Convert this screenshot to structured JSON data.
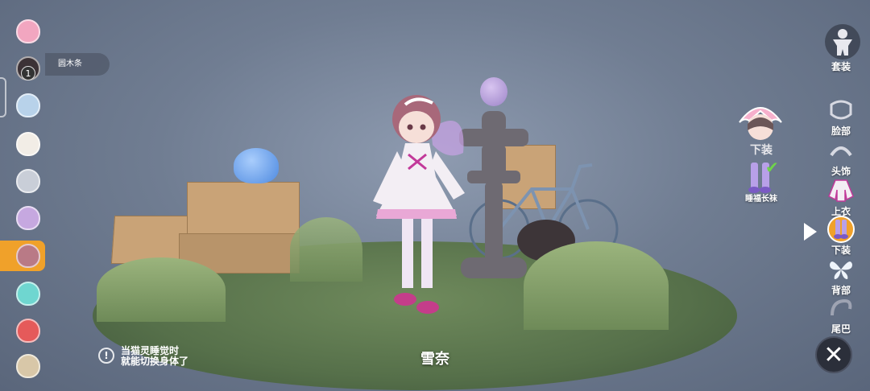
{
  "hud": {
    "hint_icon": "!",
    "hint_line1": "当猫灵睡觉时",
    "hint_line2": "就能切换身体了",
    "character_name": "雪奈"
  },
  "left_list": {
    "badge_count": "1",
    "tooltip": "圆木条",
    "items": [
      {
        "icon": "pink-cat-face-icon",
        "color": "#f2a6c0"
      },
      {
        "icon": "dark-cat-face-icon",
        "color": "#3c3236"
      },
      {
        "icon": "blue-hair-face-icon",
        "color": "#b8d2ea"
      },
      {
        "icon": "white-sheep-face-icon",
        "color": "#f2ede6"
      },
      {
        "icon": "grey-cat-face-icon",
        "color": "#c9ced8"
      },
      {
        "icon": "purple-cat-face-icon",
        "color": "#c6a8e0"
      },
      {
        "icon": "brown-hair-face-icon",
        "color": "#b97a86"
      },
      {
        "icon": "teal-hair-face-icon",
        "color": "#6fd6d0"
      },
      {
        "icon": "red-cat-face-icon",
        "color": "#e55a5a"
      },
      {
        "icon": "owl-face-icon",
        "color": "#d8c7a8"
      }
    ],
    "accent": "#f0a12a"
  },
  "right_list": {
    "categories": [
      {
        "label": "套装",
        "icon": "body-outfit-icon"
      },
      {
        "label": "脸部",
        "icon": "face-icon"
      },
      {
        "label": "头饰",
        "icon": "headband-icon"
      },
      {
        "label": "上衣",
        "icon": "top-icon"
      },
      {
        "label": "下装",
        "icon": "stockings-icon"
      },
      {
        "label": "背部",
        "icon": "butterfly-wings-icon"
      },
      {
        "label": "尾巴",
        "icon": "tail-icon"
      }
    ],
    "active": "下装",
    "close_symbol": "✕"
  },
  "sub_panel": {
    "title": "下装",
    "item_name": "睡福长袜",
    "check": "✔"
  }
}
